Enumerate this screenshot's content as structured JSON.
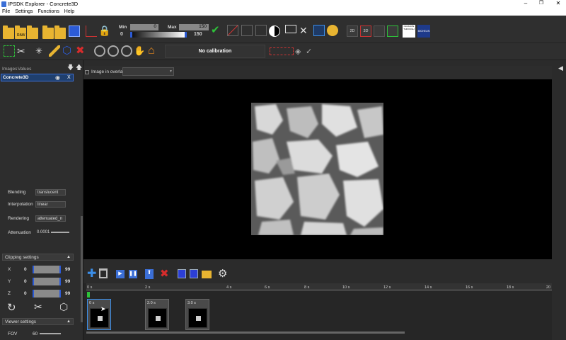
{
  "window": {
    "title": "IPSDK Explorer - Concrete3D"
  },
  "menu": [
    "File",
    "Settings",
    "Functions",
    "Help"
  ],
  "toolbar": {
    "min_label": "Min",
    "min_value": "0",
    "max_label": "Max",
    "max_value": "150",
    "range_low": "0",
    "range_high": "150",
    "view_2d": "2D",
    "view_3d": "3D",
    "calibration": "No calibration",
    "logo1": "NAVIGATE THROUGH",
    "logo2": "MICHELIN"
  },
  "left_panel": {
    "tabs": [
      "Images",
      "Values"
    ],
    "image_name": "Concrete3D",
    "remove": "X",
    "blending_label": "Blending",
    "blending_value": "translucent",
    "interpolation_label": "Interpolation",
    "interpolation_value": "linear",
    "rendering_label": "Rendering",
    "rendering_value": "attenuated_n",
    "attenuation_label": "Attenuation",
    "attenuation_value": "0.0001",
    "clipping_title": "Clipping settings",
    "clip": [
      {
        "axis": "X",
        "min": "0",
        "max": "99"
      },
      {
        "axis": "Y",
        "min": "0",
        "max": "99"
      },
      {
        "axis": "Z",
        "min": "0",
        "max": "99"
      }
    ],
    "viewer_title": "Viewer settings",
    "fov_label": "FOV",
    "fov_value": "60"
  },
  "overlay": {
    "label": "Image in overlay",
    "value": ""
  },
  "timeline": {
    "ticks": [
      "0 s",
      "2 s",
      "4 s",
      "6 s",
      "8 s",
      "10 s",
      "12 s",
      "14 s",
      "16 s",
      "18 s",
      "20"
    ],
    "keyframes": [
      "0 s",
      "2.0 s",
      "3.0 s"
    ]
  },
  "colors": {
    "accent": "#2c5bd6",
    "folder": "#e8b431",
    "background": "#2b2b2b"
  }
}
